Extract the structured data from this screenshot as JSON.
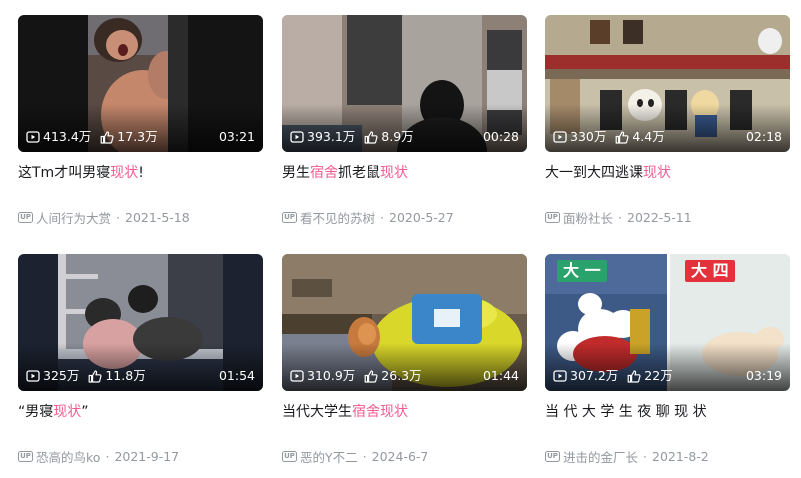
{
  "cards": [
    {
      "views": "413.4万",
      "likes": "17.3万",
      "duration": "03:21",
      "title": {
        "a": "这Tm才叫男寝",
        "h1": "现状",
        "b": "!",
        "h2": "",
        "c": ""
      },
      "author": "人间行为大赏",
      "date": "2021-5-18",
      "up": "UP"
    },
    {
      "views": "393.1万",
      "likes": "8.9万",
      "duration": "00:28",
      "title": {
        "a": "男生",
        "h1": "宿舍",
        "b": "抓老鼠",
        "h2": "现状",
        "c": ""
      },
      "author": "看不见的苏树",
      "date": "2020-5-27",
      "up": "UP"
    },
    {
      "views": "330万",
      "likes": "4.4万",
      "duration": "02:18",
      "title": {
        "a": "大一到大四逃课",
        "h1": "现状",
        "b": "",
        "h2": "",
        "c": ""
      },
      "author": "面粉社长",
      "date": "2022-5-11",
      "up": "UP"
    },
    {
      "views": "325万",
      "likes": "11.8万",
      "duration": "01:54",
      "title": {
        "a": "“男寝",
        "h1": "现状",
        "b": "”",
        "h2": "",
        "c": ""
      },
      "author": "恐高的鸟ko",
      "date": "2021-9-17",
      "up": "UP"
    },
    {
      "views": "310.9万",
      "likes": "26.3万",
      "duration": "01:44",
      "title": {
        "a": "当代大学生",
        "h1": "宿舍",
        "b": "",
        "h2": "现状",
        "c": ""
      },
      "author": "恶的Y不二",
      "date": "2024-6-7",
      "up": "UP"
    },
    {
      "views": "307.2万",
      "likes": "22万",
      "duration": "03:19",
      "title": {
        "a": "当 代 大 学 生 夜 聊 现 状",
        "h1": "",
        "b": "",
        "h2": "",
        "c": ""
      },
      "author": "进击的金厂长",
      "date": "2021-8-2",
      "up": "UP"
    }
  ],
  "thumb_text": {
    "badge_left": "大 一",
    "badge_right": "大 四"
  },
  "colors": {
    "highlight": "#f25d8e",
    "meta": "#9499a0",
    "title": "#18191c"
  }
}
